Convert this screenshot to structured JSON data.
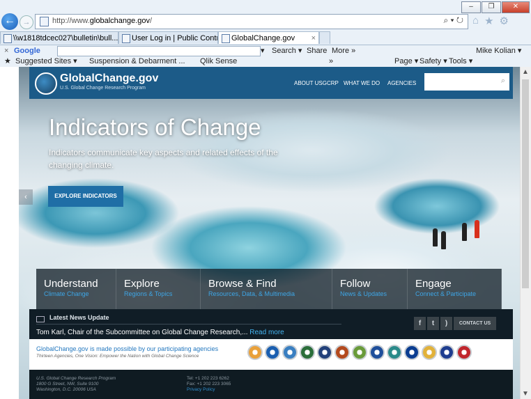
{
  "browser": {
    "address_url_prefix": "http://www.",
    "address_url_domain": "globalchange.gov",
    "address_url_suffix": "/",
    "search_glyph": "⌕ ▾ ↻",
    "tabs": [
      {
        "label": "\\\\w1818tdcec027\\bulletin\\bull..."
      },
      {
        "label": "User Log in | Public Contributi..."
      },
      {
        "label": "GlobalChange.gov"
      }
    ],
    "tab_close": "×",
    "google_bar": {
      "close": "×",
      "logo": "Google",
      "search_label": "Search ▾",
      "share_label": "Share",
      "more_label": "More »",
      "user_label": "Mike Kolian ▾",
      "chevron": "»"
    },
    "favorites": {
      "suggested": "Suggested Sites ▾",
      "suspension": "Suspension & Debarment ...",
      "qlik": "Qlik Sense",
      "page_menu": "Page ▾",
      "safety_menu": "Safety ▾",
      "tools_menu": "Tools ▾"
    }
  },
  "site": {
    "name": "GlobalChange.gov",
    "subtitle": "U.S. Global Change Research Program",
    "nav": [
      "ABOUT USGCRP",
      "WHAT WE DO",
      "AGENCIES"
    ],
    "search_placeholder": ""
  },
  "hero": {
    "title": "Indicators of Change",
    "text": "Indicators communicate key aspects and related effects of the changing climate.",
    "button": "EXPLORE INDICATORS"
  },
  "categories": [
    {
      "title": "Understand",
      "sub": "Climate Change"
    },
    {
      "title": "Explore",
      "sub": "Regions & Topics"
    },
    {
      "title": "Browse & Find",
      "sub": "Resources, Data, & Multimedia"
    },
    {
      "title": "Follow",
      "sub": "News & Updates"
    },
    {
      "title": "Engage",
      "sub": "Connect & Participate"
    }
  ],
  "news": {
    "heading": "Latest News Update",
    "text": "Tom Karl, Chair of the Subcommittee on Global Change Research,...",
    "more": "Read more",
    "contact": "CONTACT US"
  },
  "agencies": {
    "title_link": "GlobalChange.gov",
    "title_rest": " is made possible by our participating agencies",
    "subtitle": "Thirteen Agencies, One Vision: Empower the Nation with Global Change Science",
    "seal_colors": [
      "#e9a13b",
      "#1b5fb0",
      "#3a7fc1",
      "#2b6e3a",
      "#23417a",
      "#b34a1e",
      "#6a9b3a",
      "#1f4f9b",
      "#2a8a8a",
      "#0b3d91",
      "#e2b23a",
      "#1e3d8f",
      "#c0262d"
    ]
  },
  "footer": {
    "org": "U.S. Global Change Research Program",
    "street": "1800 G Street, NW, Suite 9100",
    "city": "Washington, D.C. 20006 USA",
    "tel": "Tel: +1 202 223 6262",
    "fax": "Fax: +1 202 223 3065",
    "privacy": "Privacy Policy"
  },
  "colors": {
    "header": "#1c5b88",
    "accent": "#2478bf",
    "news_link": "#44b3f0"
  }
}
